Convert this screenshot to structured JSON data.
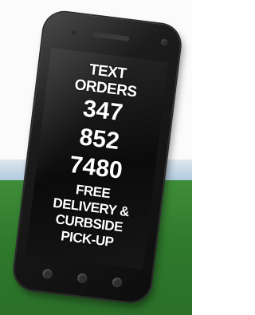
{
  "phone": {
    "headline": [
      "TEXT",
      "ORDERS"
    ],
    "number_parts": [
      "347",
      "852",
      "7480"
    ],
    "offer_lines": [
      "FREE",
      "DELIVERY &",
      "CURBSIDE",
      "PICK-UP"
    ]
  },
  "colors": {
    "phone_body": "#111111",
    "screen_text": "#ffffff",
    "grass": "#2f7a2c",
    "sky": "#a9c6dc"
  },
  "icons": [
    "back-button-icon",
    "home-button-icon",
    "menu-button-icon"
  ]
}
